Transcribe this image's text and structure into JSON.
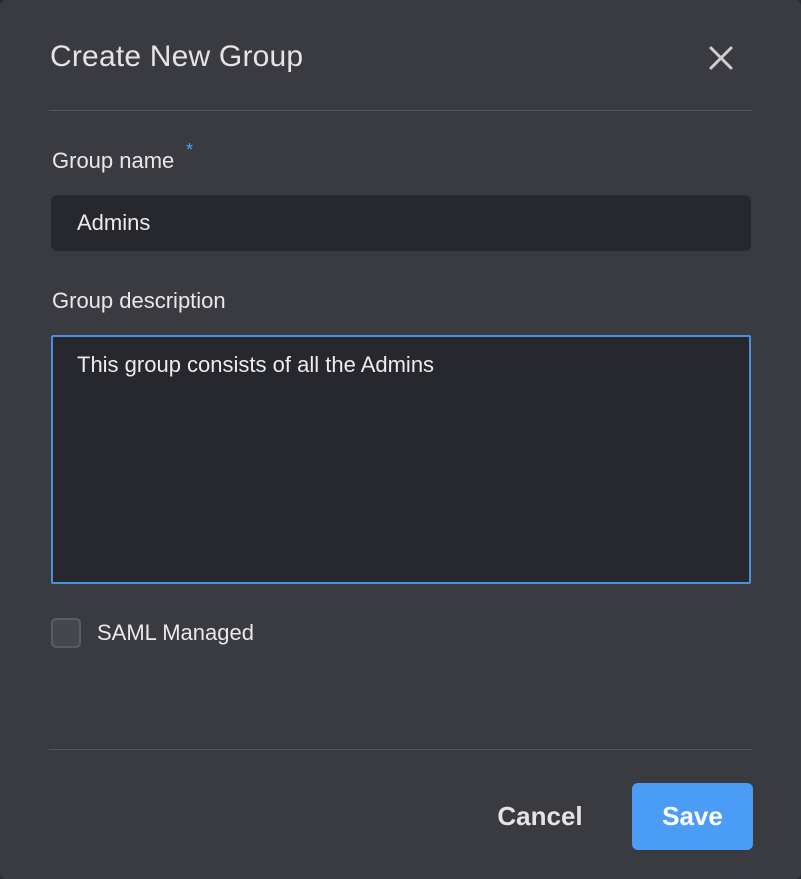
{
  "dialog": {
    "title": "Create New Group",
    "close_icon": "close-icon"
  },
  "form": {
    "group_name": {
      "label": "Group name",
      "required_marker": "*",
      "value": "Admins"
    },
    "group_description": {
      "label": "Group description",
      "value": "This group consists of all the Admins"
    },
    "saml_managed": {
      "label": "SAML Managed",
      "checked": false
    }
  },
  "footer": {
    "cancel_label": "Cancel",
    "save_label": "Save"
  },
  "colors": {
    "dialog_bg": "#3a3b41",
    "input_bg": "#27282d",
    "accent": "#4a9cf6",
    "focus_border": "#4a90e2",
    "required": "#4ea1f3"
  }
}
